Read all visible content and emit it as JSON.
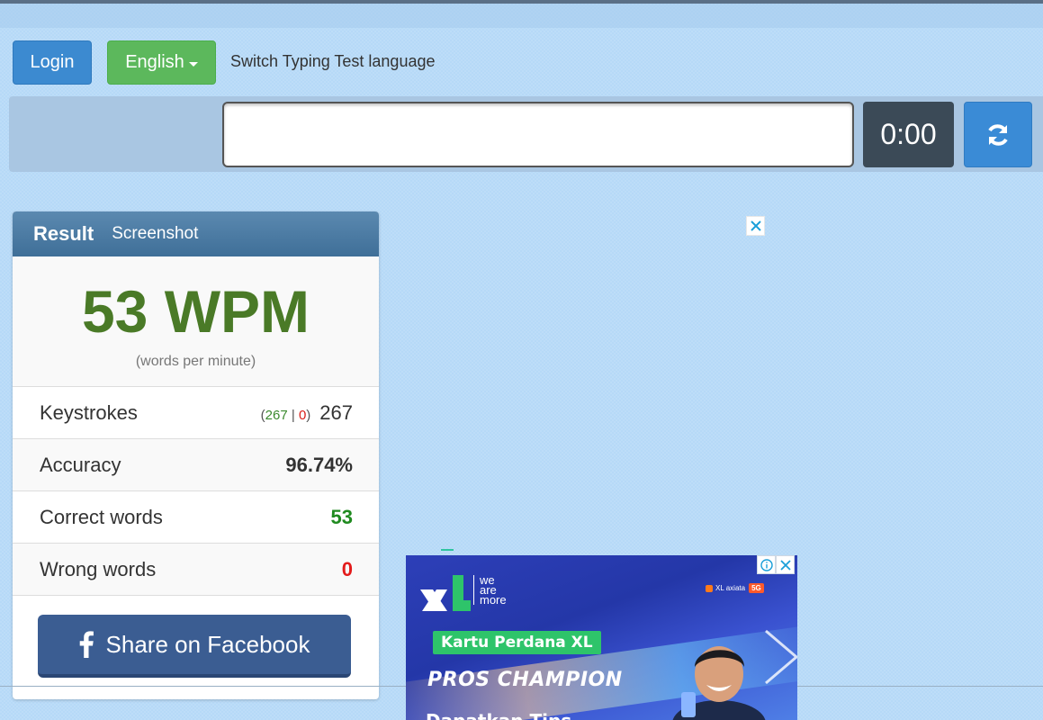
{
  "toolbar": {
    "login_label": "Login",
    "language_label": "English",
    "switch_text": "Switch Typing Test language"
  },
  "typing": {
    "input_value": "",
    "timer": "0:00"
  },
  "result": {
    "title": "Result",
    "screenshot_label": "Screenshot",
    "wpm": "53 WPM",
    "wpm_caption": "(words per minute)",
    "keystrokes": {
      "label": "Keystrokes",
      "correct": "267",
      "wrong": "0",
      "total": "267"
    },
    "accuracy": {
      "label": "Accuracy",
      "value": "96.74%"
    },
    "correct_words": {
      "label": "Correct words",
      "value": "53"
    },
    "wrong_words": {
      "label": "Wrong words",
      "value": "0"
    },
    "share_label": "Share on Facebook"
  },
  "ad": {
    "tagline": [
      "we",
      "are",
      "more"
    ],
    "brand": "XL axiata",
    "brand_badge": "5G",
    "kartu": "Kartu Perdana XL",
    "headline": "PROS CHAMPION",
    "cta": "Dapatkan Tips"
  },
  "colors": {
    "login": "#3c8ad0",
    "language": "#5cb85c",
    "timer": "#3b4a57",
    "panel_header": "#4a7aa3",
    "wpm": "#4a7a27",
    "facebook": "#3b5d92"
  }
}
